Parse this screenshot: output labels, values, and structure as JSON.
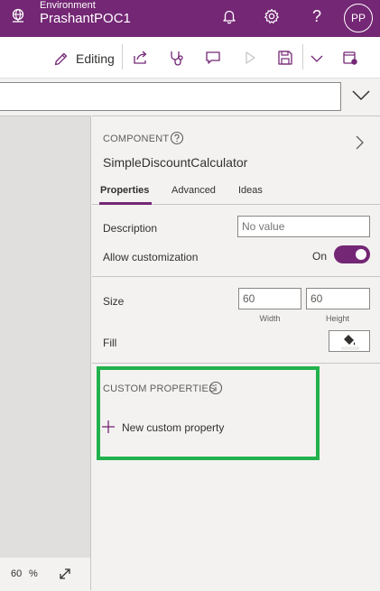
{
  "topbar": {
    "environment_label": "Environment",
    "environment_name": "PrashantPOC1",
    "avatar_initials": "PP",
    "help_label": "?",
    "icons": [
      "environment-icon",
      "bell-icon",
      "gear-icon",
      "help-icon"
    ],
    "background": "#742774"
  },
  "command_bar": {
    "editing_label": "Editing",
    "icons": [
      "pencil-icon",
      "share-icon",
      "stethoscope-icon",
      "comment-icon",
      "play-icon",
      "save-icon",
      "chevron-down-icon",
      "publish-icon"
    ]
  },
  "zoom": {
    "value": "60",
    "unit": "%"
  },
  "panel": {
    "section_label": "COMPONENT",
    "component_name": "SimpleDiscountCalculator",
    "tabs": [
      {
        "label": "Properties",
        "active": true
      },
      {
        "label": "Advanced",
        "active": false
      },
      {
        "label": "Ideas",
        "active": false
      }
    ],
    "description_label": "Description",
    "description_placeholder": "No value",
    "allow_customization_label": "Allow customization",
    "allow_customization_value": "On",
    "size_label": "Size",
    "width_value": "60",
    "height_value": "60",
    "width_caption": "Width",
    "height_caption": "Height",
    "fill_label": "Fill",
    "custom_properties_label": "CUSTOM PROPERTIES",
    "new_custom_property_label": "New custom property"
  },
  "colors": {
    "accent": "#742774",
    "highlight_box": "#22b14c"
  }
}
